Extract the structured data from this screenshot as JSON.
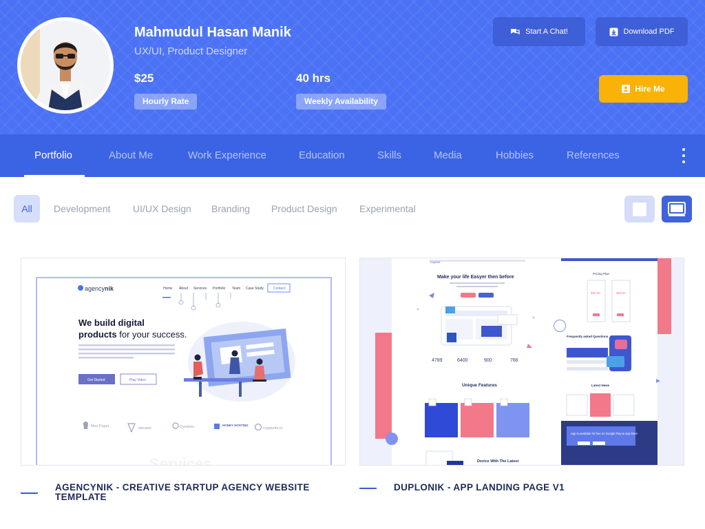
{
  "profile": {
    "name": "Mahmudul Hasan Manik",
    "role": "UX/UI, Product Designer",
    "rate_value": "$25",
    "rate_label": "Hourly Rate",
    "availability_value": "40 hrs",
    "availability_label": "Weekly Availability"
  },
  "actions": {
    "chat_label": "Start A Chat!",
    "download_label": "Download PDF",
    "hire_label": "Hire Me"
  },
  "nav": {
    "items": [
      {
        "label": "Portfolio"
      },
      {
        "label": "About Me"
      },
      {
        "label": "Work Experience"
      },
      {
        "label": "Education"
      },
      {
        "label": "Skills"
      },
      {
        "label": "Media"
      },
      {
        "label": "Hobbies"
      },
      {
        "label": "References"
      }
    ],
    "active_index": 0
  },
  "filters": {
    "items": [
      "All",
      "Development",
      "UI/UX Design",
      "Branding",
      "Product Design",
      "Experimental"
    ],
    "active_index": 0
  },
  "view_toggle": {
    "options": [
      "small-grid-view",
      "large-grid-view"
    ],
    "active": "large-grid-view"
  },
  "portfolio": {
    "cards": [
      {
        "title": "AGENCYNIK - CREATIVE STARTUP AGENCY WEBSITE TEMPLATE",
        "preview": {
          "brand_left": "agency",
          "brand_right": "nik",
          "nav_links": [
            "Home",
            "About",
            "Services",
            "Portfolio",
            "Team",
            "Case Study",
            "Contact"
          ],
          "hero_line1": "We build digital",
          "hero_line2a": "products",
          "hero_line2b": " for your success.",
          "hero_body": "Lorem ipsum dolor sit amet, consectetur adipiscing elit, sed do eiusmod tempor incididunt ut labore et dolore magna aliqua. Quis ipsum suspendisse.",
          "cta_primary": "Get Started",
          "cta_secondary": "Play Video",
          "logos": [
            "Max Paper",
            "Iskvator",
            "Dynamic",
            "HONEY HOSTING",
            "cryptorite.io"
          ],
          "section_heading": "Services"
        }
      },
      {
        "title": "DUPLONIK - APP LANDING PAGE V1",
        "preview": {
          "brand": "DupliNK",
          "hero": "Make your life Easyer then before",
          "stats": [
            "4789",
            "6400",
            "900",
            "766"
          ],
          "features_heading": "Unique Features",
          "device_heading": "Device With The Latest",
          "pricing_heading": "Pricing Plan",
          "prices": [
            "$30.00",
            "$99.00"
          ],
          "faq_heading": "Frequently asked Questions",
          "news_heading": "Latest News",
          "app_banner": "App is available for free on Google Play & App Store"
        }
      }
    ]
  },
  "colors": {
    "header_bg": "#4b72f5",
    "nav_bg": "#3b64e4",
    "hire_button": "#f9b208",
    "title_text": "#1d2a57"
  }
}
